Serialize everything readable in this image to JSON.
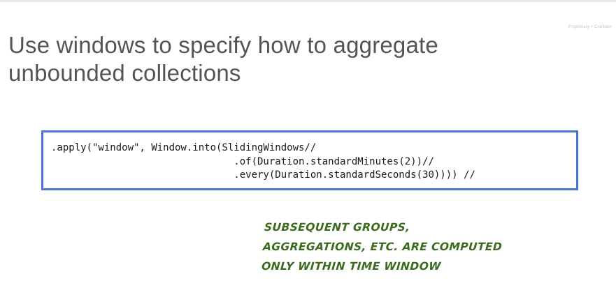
{
  "slide": {
    "confidentiality_label": "Proprietary + Confiden",
    "title_lines": [
      "Use windows to specify how to aggregate",
      "unbounded collections"
    ]
  },
  "code": {
    "lines": [
      ".apply(\"window\", Window.into(SlidingWindows//",
      "                               .of(Duration.standardMinutes(2))//",
      "                               .every(Duration.standardSeconds(30)))) //"
    ]
  },
  "annotation": {
    "lines": [
      "SUBSEQUENT GROUPS,",
      "AGGREGATIONS, ETC. ARE COMPUTED",
      "ONLY WITHIN TIME WINDOW"
    ]
  },
  "colors": {
    "title_text": "#545454",
    "code_border": "#4a74d0",
    "annotation_ink": "#3a6b1c"
  }
}
